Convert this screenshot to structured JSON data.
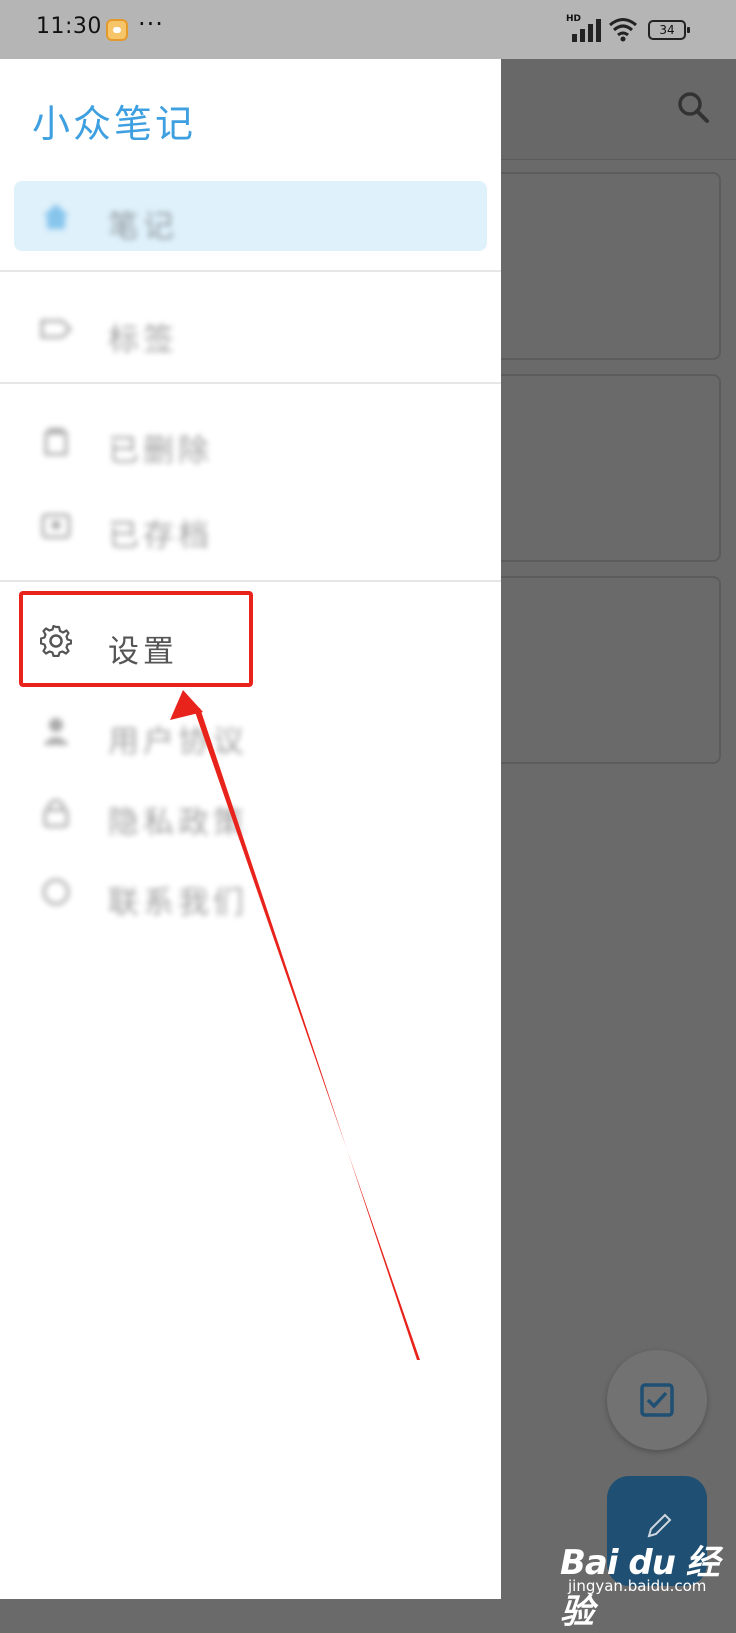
{
  "status_bar": {
    "time": "11:30",
    "more": "···",
    "hd": "HD",
    "battery": "34"
  },
  "drawer": {
    "app_title": "小众笔记",
    "items": [
      {
        "label": "笔记",
        "icon": "home-icon",
        "blurred": true,
        "active": true
      },
      {
        "label": "标签",
        "icon": "tag-icon",
        "blurred": true
      },
      {
        "label": "已删除",
        "icon": "trash-icon",
        "blurred": true
      },
      {
        "label": "已存档",
        "icon": "archive-icon",
        "blurred": true
      },
      {
        "label": "设置",
        "icon": "gear-icon",
        "blurred": false
      },
      {
        "label": "用户协议",
        "icon": "user-icon",
        "blurred": true
      },
      {
        "label": "隐私政策",
        "icon": "lock-icon",
        "blurred": true
      },
      {
        "label": "联系我们",
        "icon": "chat-icon",
        "blurred": true
      }
    ]
  },
  "background": {
    "search_icon": "search-icon",
    "fab_checklist_icon": "checkbox-icon",
    "fab_new_note_icon": "pencil-icon"
  },
  "annotation": {
    "highlight_color": "#e8231c",
    "target": "设置"
  },
  "watermark": {
    "logo": "Bai du 经验",
    "url": "jingyan.baidu.com"
  },
  "colors": {
    "accent": "#3ea0e0",
    "active_bg": "#dff1fb",
    "fab_primary": "#1f4f72"
  }
}
